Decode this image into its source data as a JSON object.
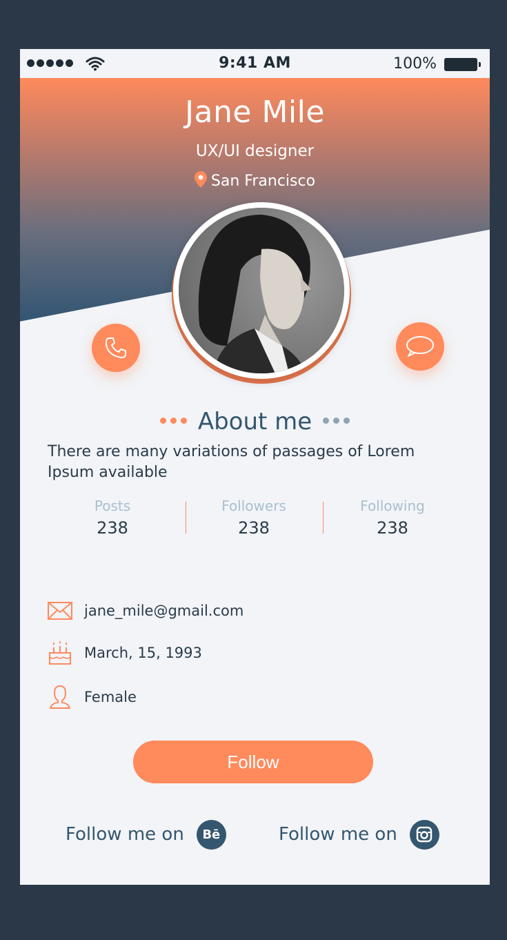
{
  "status_bar": {
    "time": "9:41 AM",
    "battery": "100%"
  },
  "profile": {
    "name": "Jane Mile",
    "role": "UX/UI designer",
    "location": "San Francisco"
  },
  "about": {
    "title": "About me",
    "text": "There are many variations of passages of Lorem Ipsum available"
  },
  "stats": [
    {
      "label": "Posts",
      "value": "238"
    },
    {
      "label": "Followers",
      "value": "238"
    },
    {
      "label": "Following",
      "value": "238"
    }
  ],
  "info": {
    "email": "jane_mile@gmail.com",
    "birthday": "March, 15, 1993",
    "gender": "Female"
  },
  "follow_label": "Follow",
  "social": [
    {
      "label": "Follow me on",
      "icon": "behance-icon",
      "glyph": "Bē"
    },
    {
      "label": "Follow me on",
      "icon": "instagram-icon",
      "glyph": ""
    }
  ],
  "colors": {
    "accent": "#ff8a5c",
    "primary": "#34566e",
    "frame": "#2a3847"
  }
}
